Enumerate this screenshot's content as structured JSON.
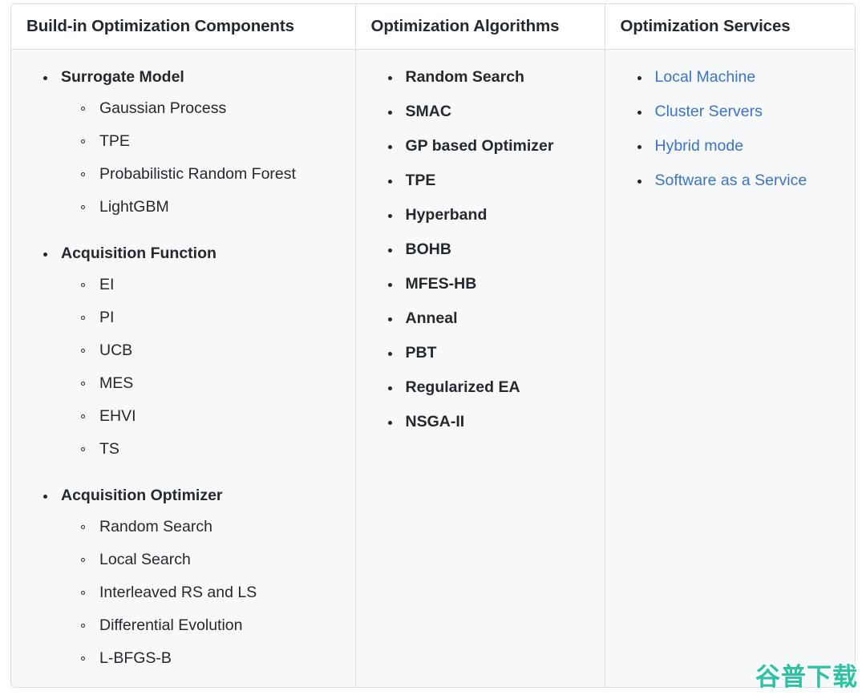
{
  "table": {
    "columns": [
      {
        "header": "Build-in Optimization Components",
        "kind": "nested",
        "groups": [
          {
            "label": "Surrogate Model",
            "children": [
              "Gaussian Process",
              "TPE",
              "Probabilistic Random Forest",
              "LightGBM"
            ]
          },
          {
            "label": "Acquisition Function",
            "children": [
              "EI",
              "PI",
              "UCB",
              "MES",
              "EHVI",
              "TS"
            ]
          },
          {
            "label": "Acquisition Optimizer",
            "children": [
              "Random Search",
              "Local Search",
              "Interleaved RS and LS",
              "Differential Evolution",
              "L-BFGS-B"
            ]
          }
        ]
      },
      {
        "header": "Optimization Algorithms",
        "kind": "flat",
        "items": [
          "Random Search",
          "SMAC",
          "GP based Optimizer",
          "TPE",
          "Hyperband",
          "BOHB",
          "MFES-HB",
          "Anneal",
          "PBT",
          "Regularized EA",
          "NSGA-II"
        ]
      },
      {
        "header": "Optimization Services",
        "kind": "links",
        "items": [
          "Local Machine",
          "Cluster Servers",
          "Hybrid mode",
          "Software as a Service"
        ]
      }
    ]
  },
  "watermark": {
    "text": "谷普下载"
  },
  "colors": {
    "text": "#24292e",
    "link": "#3b73c9",
    "border": "#d8dee4",
    "body_bg": "#f6f8fa",
    "header_bg": "#ffffff",
    "watermark": "#2ec2a4"
  }
}
